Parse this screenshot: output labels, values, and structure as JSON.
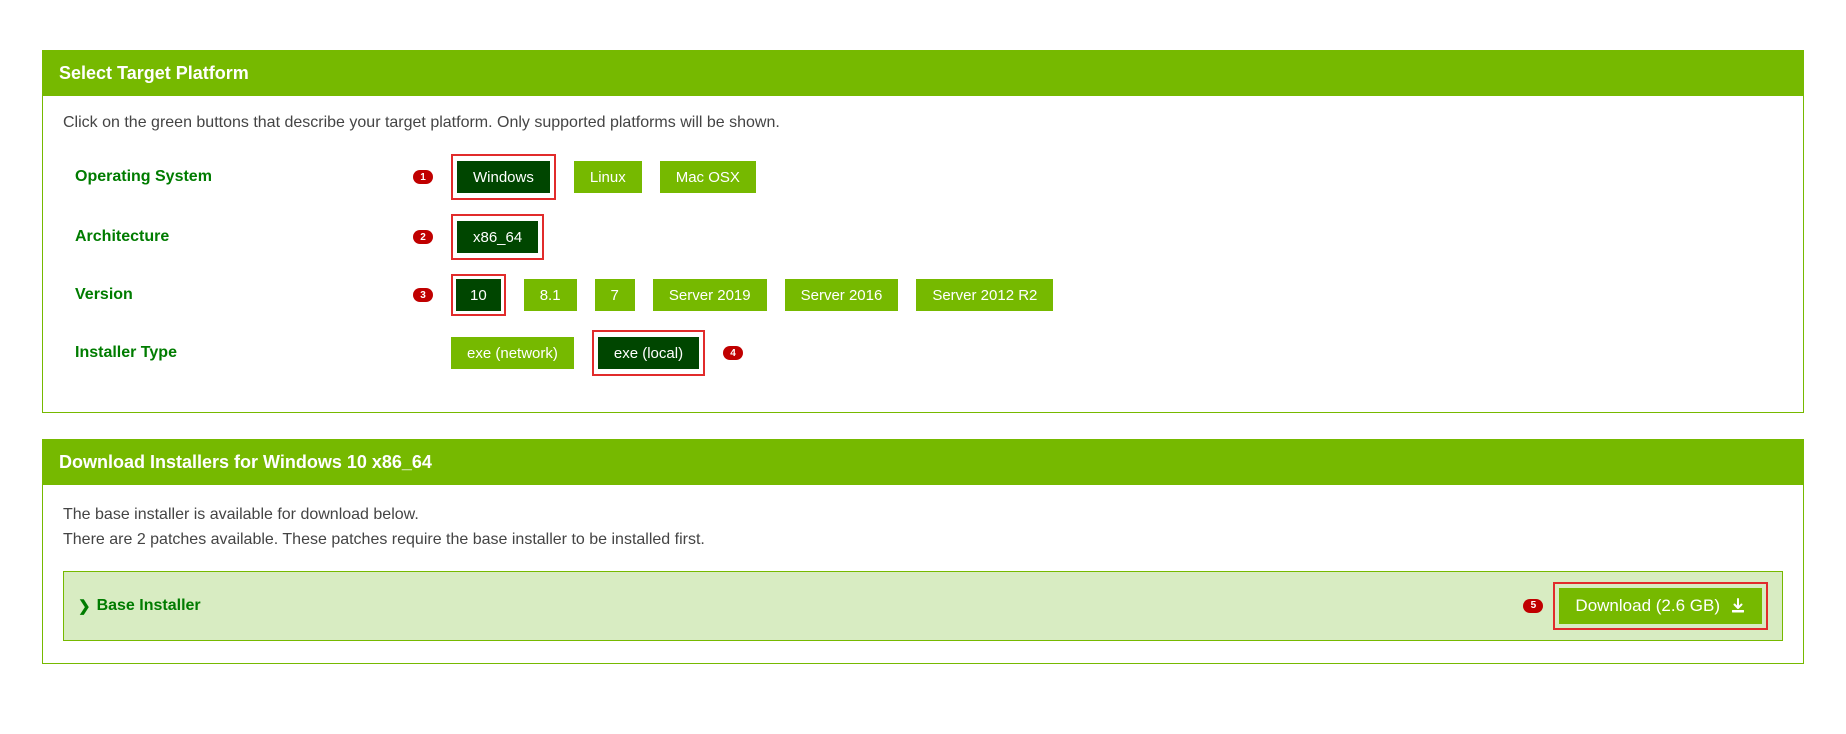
{
  "platform": {
    "header": "Select Target Platform",
    "intro": "Click on the green buttons that describe your target platform. Only supported platforms will be shown.",
    "rows": {
      "os": {
        "label": "Operating System",
        "callout": "1",
        "options": [
          "Windows",
          "Linux",
          "Mac OSX"
        ],
        "selected": "Windows"
      },
      "arch": {
        "label": "Architecture",
        "callout": "2",
        "options": [
          "x86_64"
        ],
        "selected": "x86_64"
      },
      "version": {
        "label": "Version",
        "callout": "3",
        "options": [
          "10",
          "8.1",
          "7",
          "Server 2019",
          "Server 2016",
          "Server 2012 R2"
        ],
        "selected": "10"
      },
      "installer": {
        "label": "Installer Type",
        "callout": "4",
        "options": [
          "exe (network)",
          "exe (local)"
        ],
        "selected": "exe (local)"
      }
    }
  },
  "download": {
    "header": "Download Installers for Windows 10 x86_64",
    "desc_line1": "The base installer is available for download below.",
    "desc_line2": "There are 2 patches available. These patches require the base installer to be installed first.",
    "base_label": "Base Installer",
    "callout": "5",
    "button_label": "Download (2.6 GB)"
  }
}
